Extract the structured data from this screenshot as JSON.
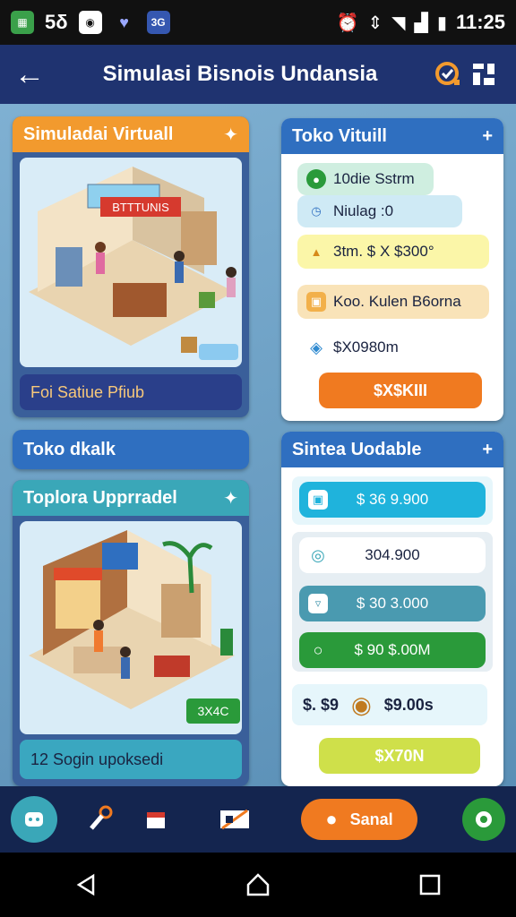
{
  "status": {
    "left_text": "5δ",
    "time": "11:25"
  },
  "appbar": {
    "title": "Simulasi Bisnois Undansia"
  },
  "card_virtual": {
    "title": "Simuladai Virtuall",
    "caption": "Foi Satiue Pfiub",
    "sign": "BTTTUNIS"
  },
  "toko_virtual": {
    "title": "Toko Vituill",
    "rows": [
      "10die Sstrm",
      "Niulag :0",
      "3tm. $ X $300°",
      "Koo. Kulen B6orna",
      "$X0980m"
    ],
    "button": "$X$KIII"
  },
  "toko_lokal": {
    "title": "Toko dkalk"
  },
  "card_upgrade": {
    "title": "Toplora Upprradel",
    "badge": "3X4C",
    "caption": "12 Sogin upoksedi"
  },
  "simulasi": {
    "title": "Sintea Uodable",
    "rows": [
      "$ 36 9.900",
      "304.900",
      "$ 30 3.000",
      "$ 90 $.00M"
    ],
    "summary_left": "$. $9",
    "summary_right": "$9.00s",
    "button": "$X70N"
  },
  "bottomnav": {
    "action": "Sanal"
  },
  "colors": {
    "orange": "#f29a2e",
    "navy": "#1f3370",
    "blue": "#2f6fc0",
    "teal": "#3aa7b8",
    "green": "#2a9a3a",
    "lime": "#cfe04a"
  }
}
